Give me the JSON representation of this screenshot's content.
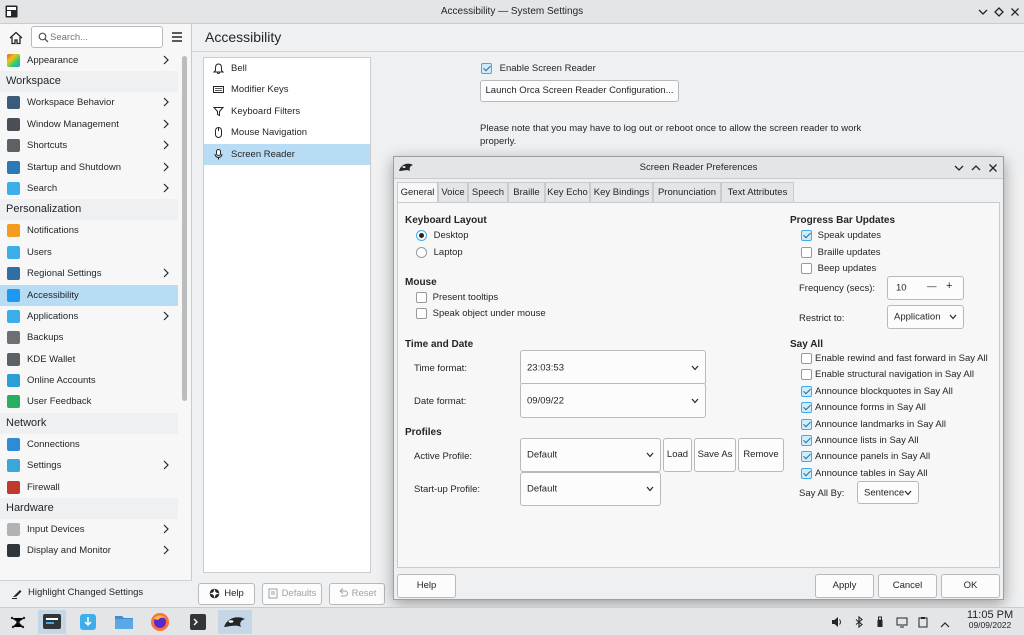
{
  "window": {
    "title": "Accessibility — System Settings"
  },
  "sidebar": {
    "search_placeholder": "Search...",
    "sections": [
      {
        "title": "",
        "items": [
          {
            "label": "Appearance",
            "icon": "appearance-icon",
            "chevron": true
          }
        ]
      },
      {
        "title": "Workspace",
        "items": [
          {
            "label": "Workspace Behavior",
            "icon": "workspace-behavior-icon",
            "chevron": true
          },
          {
            "label": "Window Management",
            "icon": "window-management-icon",
            "chevron": true
          },
          {
            "label": "Shortcuts",
            "icon": "shortcuts-icon",
            "chevron": true
          },
          {
            "label": "Startup and Shutdown",
            "icon": "startup-icon",
            "chevron": true
          },
          {
            "label": "Search",
            "icon": "search-icon",
            "chevron": true
          }
        ]
      },
      {
        "title": "Personalization",
        "items": [
          {
            "label": "Notifications",
            "icon": "notifications-icon",
            "chevron": false
          },
          {
            "label": "Users",
            "icon": "users-icon",
            "chevron": false
          },
          {
            "label": "Regional Settings",
            "icon": "regional-icon",
            "chevron": true
          },
          {
            "label": "Accessibility",
            "icon": "accessibility-icon",
            "chevron": false,
            "selected": true
          },
          {
            "label": "Applications",
            "icon": "applications-icon",
            "chevron": true
          },
          {
            "label": "Backups",
            "icon": "backups-icon",
            "chevron": false
          },
          {
            "label": "KDE Wallet",
            "icon": "wallet-icon",
            "chevron": false
          },
          {
            "label": "Online Accounts",
            "icon": "online-accounts-icon",
            "chevron": false
          },
          {
            "label": "User Feedback",
            "icon": "feedback-icon",
            "chevron": false
          }
        ]
      },
      {
        "title": "Network",
        "items": [
          {
            "label": "Connections",
            "icon": "connections-icon",
            "chevron": false
          },
          {
            "label": "Settings",
            "icon": "network-settings-icon",
            "chevron": true
          },
          {
            "label": "Firewall",
            "icon": "firewall-icon",
            "chevron": false
          }
        ]
      },
      {
        "title": "Hardware",
        "items": [
          {
            "label": "Input Devices",
            "icon": "input-devices-icon",
            "chevron": true
          },
          {
            "label": "Display and Monitor",
            "icon": "display-icon",
            "chevron": true
          }
        ]
      }
    ],
    "highlight_label": "Highlight Changed Settings"
  },
  "page": {
    "title": "Accessibility",
    "categories": [
      {
        "label": "Bell",
        "icon": "bell-icon"
      },
      {
        "label": "Modifier Keys",
        "icon": "keyboard-icon"
      },
      {
        "label": "Keyboard Filters",
        "icon": "filter-icon"
      },
      {
        "label": "Mouse Navigation",
        "icon": "mouse-icon"
      },
      {
        "label": "Screen Reader",
        "icon": "screen-reader-icon",
        "selected": true
      }
    ],
    "enable_screen_reader": "Enable Screen Reader",
    "launch_orca": "Launch Orca Screen Reader Configuration...",
    "note_line1": "Please note that you may have to log out or reboot once to allow the screen reader to work",
    "note_line2": "properly.",
    "help": "Help",
    "defaults": "Defaults",
    "reset": "Reset"
  },
  "dialog": {
    "title": "Screen Reader Preferences",
    "tabs": [
      "General",
      "Voice",
      "Speech",
      "Braille",
      "Key Echo",
      "Key Bindings",
      "Pronunciation",
      "Text Attributes"
    ],
    "keyboard_layout": {
      "title": "Keyboard Layout",
      "desktop": "Desktop",
      "laptop": "Laptop"
    },
    "mouse": {
      "title": "Mouse",
      "present_tooltips": "Present tooltips",
      "speak_object": "Speak object under mouse"
    },
    "time_date": {
      "title": "Time and Date",
      "time_label": "Time format:",
      "time_value": "23:03:53",
      "date_label": "Date format:",
      "date_value": "09/09/22"
    },
    "profiles": {
      "title": "Profiles",
      "active_label": "Active Profile:",
      "active_value": "Default",
      "load": "Load",
      "save_as": "Save As",
      "remove": "Remove",
      "startup_label": "Start-up Profile:",
      "startup_value": "Default"
    },
    "progress": {
      "title": "Progress Bar Updates",
      "speak": "Speak updates",
      "braille": "Braille updates",
      "beep": "Beep updates",
      "freq_label": "Frequency (secs):",
      "freq_value": "10",
      "minus": "—",
      "plus": "+",
      "restrict_label": "Restrict to:",
      "restrict_value": "Application"
    },
    "say_all": {
      "title": "Say All",
      "options": [
        {
          "label": "Enable rewind and fast forward in Say All",
          "checked": false
        },
        {
          "label": "Enable structural navigation in Say All",
          "checked": false
        },
        {
          "label": "Announce blockquotes in Say All",
          "checked": true
        },
        {
          "label": "Announce forms in Say All",
          "checked": true
        },
        {
          "label": "Announce landmarks in Say All",
          "checked": true
        },
        {
          "label": "Announce lists in Say All",
          "checked": true
        },
        {
          "label": "Announce panels in Say All",
          "checked": true
        },
        {
          "label": "Announce tables in Say All",
          "checked": true
        }
      ],
      "by_label": "Say All By:",
      "by_value": "Sentence"
    },
    "help": "Help",
    "apply": "Apply",
    "cancel": "Cancel",
    "ok": "OK"
  },
  "taskbar": {
    "time": "11:05 PM",
    "date": "09/09/2022"
  },
  "colors": {
    "selection": "#b8dcf4",
    "accent": "#3daee9"
  }
}
